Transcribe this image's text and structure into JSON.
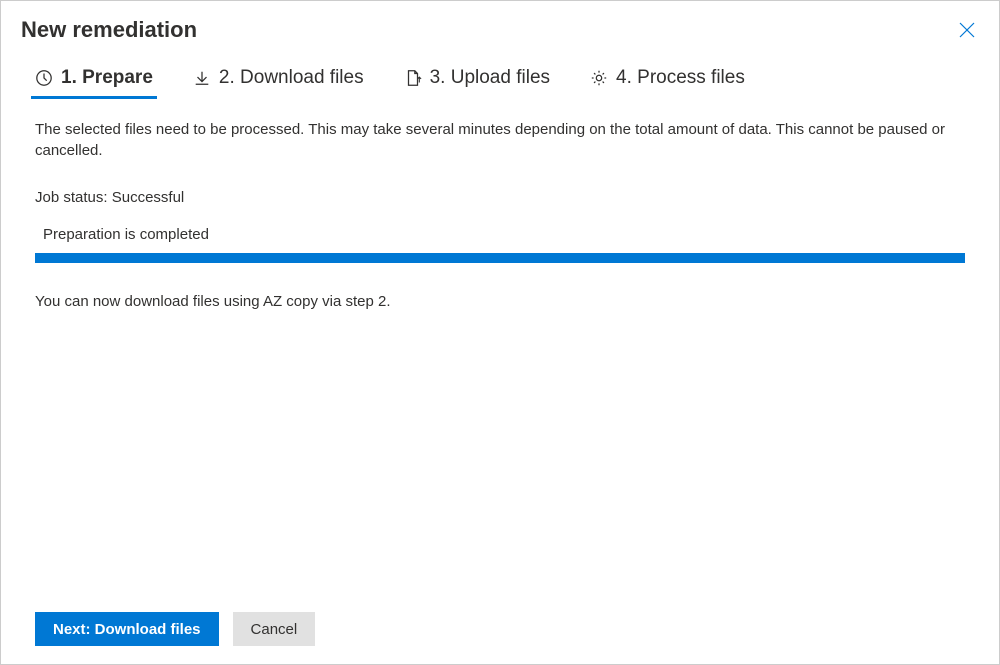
{
  "header": {
    "title": "New remediation"
  },
  "tabs": [
    {
      "label": "1. Prepare",
      "icon": "clock"
    },
    {
      "label": "2. Download files",
      "icon": "download"
    },
    {
      "label": "3. Upload files",
      "icon": "upload-doc"
    },
    {
      "label": "4. Process files",
      "icon": "gear"
    }
  ],
  "main": {
    "description": "The selected files need to be processed. This may take several minutes depending on the total amount of data. This cannot be paused or cancelled.",
    "job_status_label": "Job status:",
    "job_status_value": "Successful",
    "progress_label": "Preparation is completed",
    "progress_percent": 100,
    "hint": "You can now download files using AZ copy via step 2."
  },
  "footer": {
    "primary_label": "Next: Download files",
    "secondary_label": "Cancel"
  },
  "colors": {
    "accent": "#0078d4"
  }
}
